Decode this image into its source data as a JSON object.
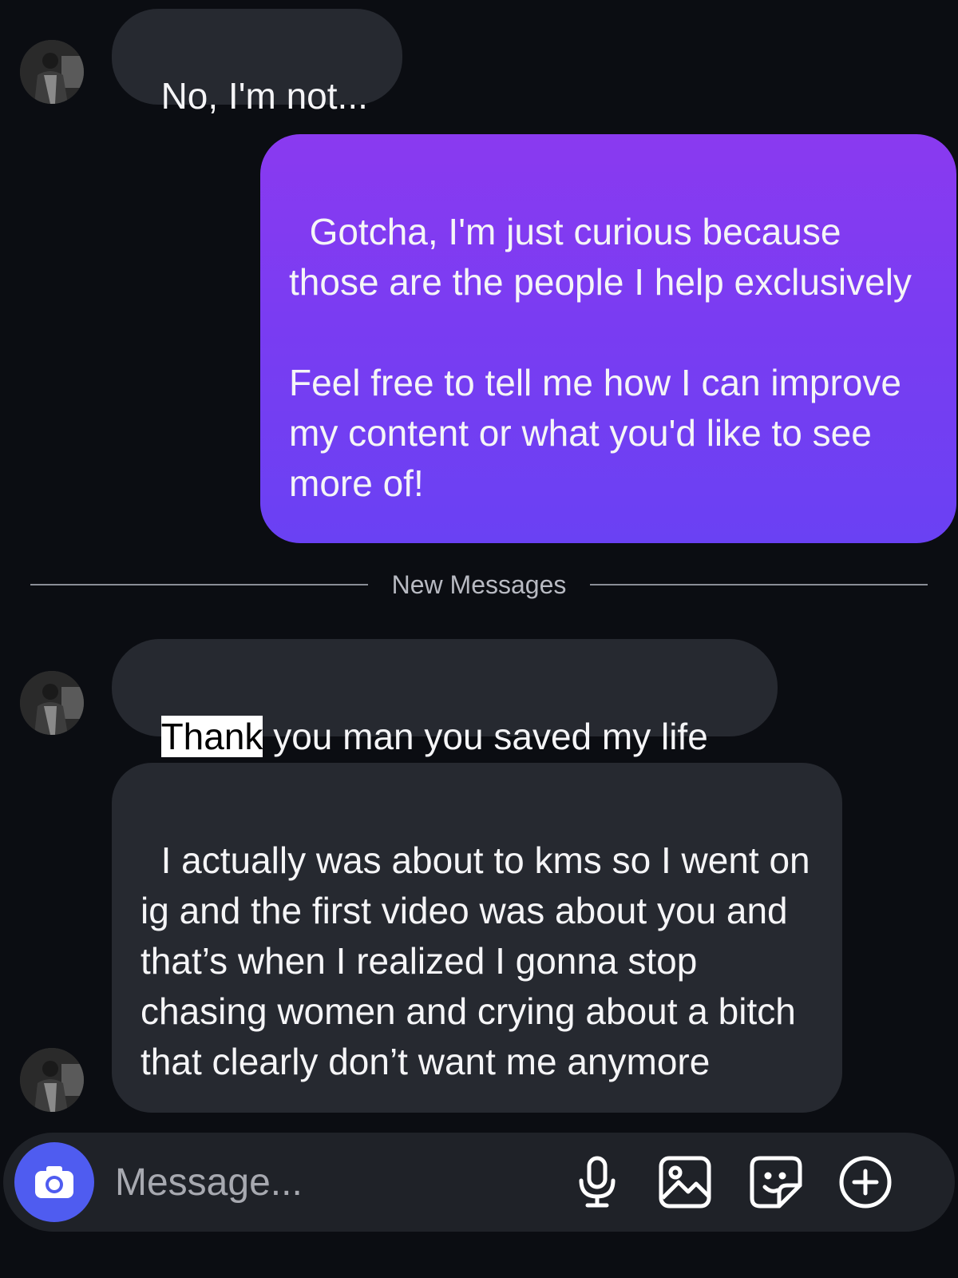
{
  "messages": [
    {
      "sender": "them",
      "text": "No, I'm not..."
    },
    {
      "sender": "me",
      "text": "Gotcha, I'm just curious because those are the people I help exclusively\n\nFeel free to tell me how I can improve my content or what you'd like to see more of!"
    },
    {
      "sender": "them",
      "highlighted": "Thank",
      "rest": " you man you saved my life"
    },
    {
      "sender": "them",
      "text": "I actually was about to kms so I went on ig and the first video was about you and that’s when I realized I gonna stop chasing women and crying about a bitch that clearly don’t want me anymore"
    }
  ],
  "divider": {
    "label": "New Messages"
  },
  "composer": {
    "placeholder": "Message...",
    "icons": [
      "camera-icon",
      "microphone-icon",
      "gallery-icon",
      "sticker-icon",
      "plus-icon"
    ]
  },
  "colors": {
    "background": "#0b0d12",
    "incoming_bubble": "#262930",
    "outgoing_bubble_top": "#8a3af0",
    "outgoing_bubble_bottom": "#6a41f3",
    "camera_button": "#4f5cf0"
  }
}
